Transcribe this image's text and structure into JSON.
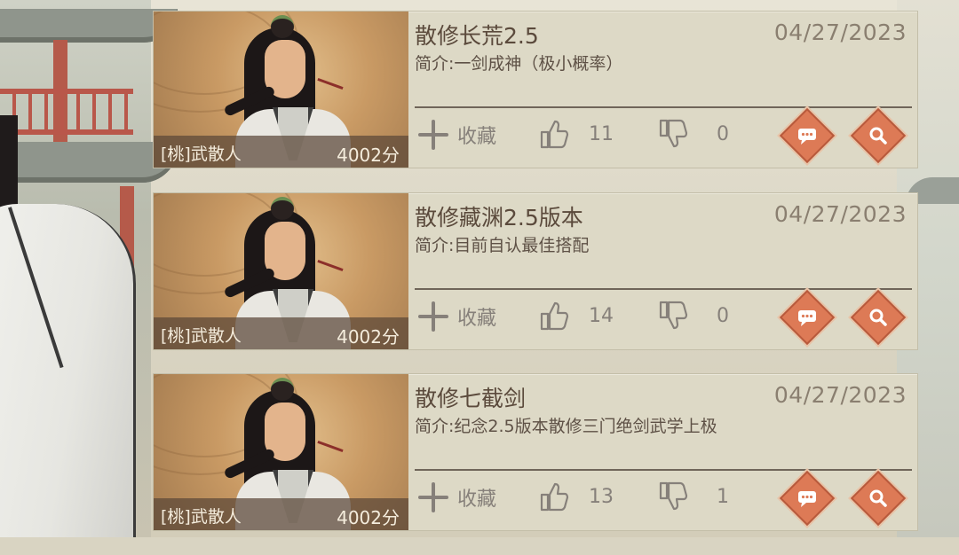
{
  "posts": [
    {
      "title": "散修长荒2.5",
      "date": "04/27/2023",
      "summary": "简介:一剑成神（极小概率）",
      "author": "[桃]武散人",
      "score": "4002分",
      "favorite_label": "收藏",
      "likes": "11",
      "dislikes": "0"
    },
    {
      "title": "散修藏渊2.5版本",
      "date": "04/27/2023",
      "summary": "简介:目前自认最佳搭配",
      "author": "[桃]武散人",
      "score": "4002分",
      "favorite_label": "收藏",
      "likes": "14",
      "dislikes": "0"
    },
    {
      "title": "散修七截剑",
      "date": "04/27/2023",
      "summary": "简介:纪念2.5版本散修三门绝剑武学上极",
      "author": "[桃]武散人",
      "score": "4002分",
      "favorite_label": "收藏",
      "likes": "13",
      "dislikes": "1"
    }
  ],
  "icons": {
    "favorite": "plus-icon",
    "like": "thumbs-up-icon",
    "dislike": "thumbs-down-icon",
    "comment": "comment-icon",
    "view": "search-icon"
  },
  "colors": {
    "card_bg": "#ddd9c6",
    "accent_button": "#dd7a56",
    "title_text": "#5b4a3c",
    "muted_text": "#86807a"
  }
}
